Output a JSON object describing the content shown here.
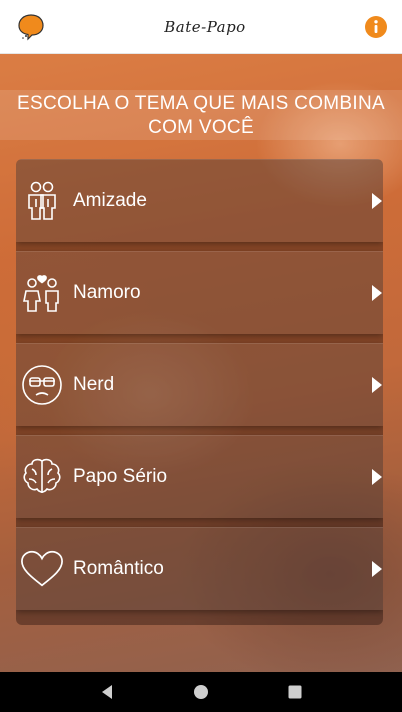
{
  "app": {
    "title": "Bate-Papo"
  },
  "colors": {
    "accent": "#f08a1c",
    "header_bg": "#ffffff",
    "overlay": "#e6783a"
  },
  "headline": "ESCOLHA O TEMA QUE MAIS COMBINA COM VOCÊ",
  "themes": [
    {
      "label": "Amizade",
      "icon": "friendship-icon"
    },
    {
      "label": "Namoro",
      "icon": "couple-icon"
    },
    {
      "label": "Nerd",
      "icon": "nerd-face-icon"
    },
    {
      "label": "Papo Sério",
      "icon": "brain-icon"
    },
    {
      "label": "Romântico",
      "icon": "heart-icon"
    }
  ],
  "icons": {
    "logo": "chat-bubble-logo",
    "info": "info-icon",
    "chevron": "chevron-right-icon",
    "nav": [
      "back-icon",
      "home-icon",
      "recents-icon"
    ]
  }
}
